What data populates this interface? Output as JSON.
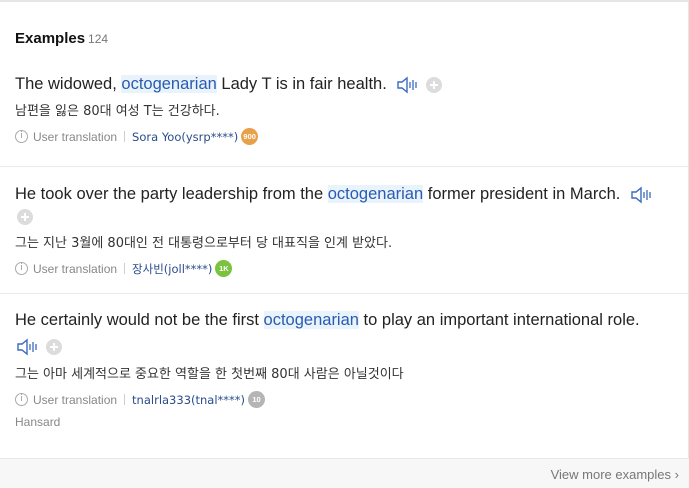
{
  "header": {
    "title": "Examples",
    "count": "124"
  },
  "examples": [
    {
      "pre": "The widowed, ",
      "highlight": "octogenarian",
      "post": " Lady T is in fair health.",
      "translation": "남편을 잃은 80대 여성 T는 건강하다.",
      "source_label": "User translation",
      "user": "Sora Yoo(ysrp****)",
      "badge": "900",
      "badge_color": "#e8a04a"
    },
    {
      "pre": "He took over the party leadership from the ",
      "highlight": "octogenarian",
      "post": " former president in March.",
      "translation": "그는 지난 3월에 80대인 전 대통령으로부터 당 대표직을 인계 받았다.",
      "source_label": "User translation",
      "user": "장사빈(joll****)",
      "badge": "1K",
      "badge_color": "#7bc23f"
    },
    {
      "pre": "He certainly would not be the first ",
      "highlight": "octogenarian",
      "post": " to play an important international role.",
      "translation": "그는 아마 세계적으로 중요한 역할을 한 첫번째 80대 사람은 아닐것이다",
      "source_label": "User translation",
      "user": "tnalrla333(tnal****)",
      "badge": "10",
      "badge_color": "#b5b5b5"
    }
  ],
  "source": "Hansard",
  "footer": {
    "more_label": "View more examples"
  },
  "icons": {
    "speaker": "speaker-icon",
    "plus": "add-icon",
    "info": "info-icon",
    "chevron": "chevron-right-icon"
  },
  "colors": {
    "highlight_bg": "#e9f3fc",
    "link": "#2a5bb0"
  }
}
